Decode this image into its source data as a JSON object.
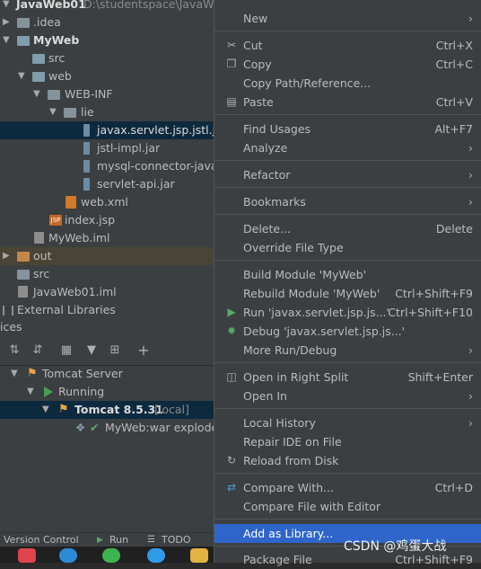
{
  "project_tree": {
    "root": {
      "name": "JavaWeb01",
      "path": "D:\\studentspace\\JavaWe..."
    },
    "items": [
      {
        "label": ".idea",
        "icon": "folder-icon"
      },
      {
        "label": "MyWeb",
        "icon": "module-folder-icon"
      },
      {
        "label": "src",
        "icon": "source-folder-icon"
      },
      {
        "label": "web",
        "icon": "web-folder-icon"
      },
      {
        "label": "WEB-INF",
        "icon": "folder-icon"
      },
      {
        "label": "lie",
        "icon": "folder-icon"
      },
      {
        "label": "javax.servlet.jsp.jstl.jar",
        "icon": "jar-icon"
      },
      {
        "label": "jstl-impl.jar",
        "icon": "jar-icon"
      },
      {
        "label": "mysql-connector-java-",
        "icon": "jar-icon"
      },
      {
        "label": "servlet-api.jar",
        "icon": "jar-icon"
      },
      {
        "label": "web.xml",
        "icon": "xml-file-icon"
      },
      {
        "label": "index.jsp",
        "icon": "jsp-file-icon"
      },
      {
        "label": "MyWeb.iml",
        "icon": "iml-file-icon"
      },
      {
        "label": "out",
        "icon": "excluded-folder-icon"
      },
      {
        "label": "src",
        "icon": "source-folder-icon"
      },
      {
        "label": "JavaWeb01.iml",
        "icon": "iml-file-icon"
      },
      {
        "label": "External Libraries",
        "icon": "libraries-icon"
      }
    ]
  },
  "services": {
    "title": "ices",
    "tree": [
      {
        "label": "Tomcat Server"
      },
      {
        "label": "Running"
      },
      {
        "label": "Tomcat 8.5.31",
        "suffix": "[local]"
      },
      {
        "label": "MyWeb:war explode"
      }
    ]
  },
  "status_bar": {
    "version_control": "Version Control",
    "run": "Run",
    "todo": "TODO"
  },
  "context_menu": {
    "items": [
      {
        "label": "New",
        "shortcut": "",
        "submenu": true
      },
      {
        "label": "Cut",
        "shortcut": "Ctrl+X",
        "icon": "scissors-icon"
      },
      {
        "label": "Copy",
        "shortcut": "Ctrl+C",
        "icon": "copy-icon"
      },
      {
        "label": "Copy Path/Reference...",
        "shortcut": ""
      },
      {
        "label": "Paste",
        "shortcut": "Ctrl+V",
        "icon": "paste-icon"
      },
      {
        "label": "Find Usages",
        "shortcut": "Alt+F7"
      },
      {
        "label": "Analyze",
        "shortcut": "",
        "submenu": true
      },
      {
        "label": "Refactor",
        "shortcut": "",
        "submenu": true
      },
      {
        "label": "Bookmarks",
        "shortcut": "",
        "submenu": true
      },
      {
        "label": "Delete...",
        "shortcut": "Delete"
      },
      {
        "label": "Override File Type",
        "shortcut": ""
      },
      {
        "label": "Build Module 'MyWeb'",
        "shortcut": ""
      },
      {
        "label": "Rebuild Module 'MyWeb'",
        "shortcut": "Ctrl+Shift+F9"
      },
      {
        "label": "Run 'javax.servlet.jsp.js...'",
        "shortcut": "Ctrl+Shift+F10",
        "icon": "run-icon"
      },
      {
        "label": "Debug 'javax.servlet.jsp.js...'",
        "shortcut": "",
        "icon": "debug-icon"
      },
      {
        "label": "More Run/Debug",
        "shortcut": "",
        "submenu": true
      },
      {
        "label": "Open in Right Split",
        "shortcut": "Shift+Enter",
        "icon": "split-icon"
      },
      {
        "label": "Open In",
        "shortcut": "",
        "submenu": true
      },
      {
        "label": "Local History",
        "shortcut": "",
        "submenu": true
      },
      {
        "label": "Repair IDE on File",
        "shortcut": ""
      },
      {
        "label": "Reload from Disk",
        "shortcut": "",
        "icon": "reload-icon"
      },
      {
        "label": "Compare With...",
        "shortcut": "Ctrl+D",
        "icon": "compare-icon"
      },
      {
        "label": "Compare File with Editor",
        "shortcut": ""
      },
      {
        "label": "Add as Library...",
        "shortcut": ""
      },
      {
        "label": "Package File",
        "shortcut": "Ctrl+Shift+F9"
      }
    ]
  },
  "watermark": "CSDN @鸡蛋大战"
}
